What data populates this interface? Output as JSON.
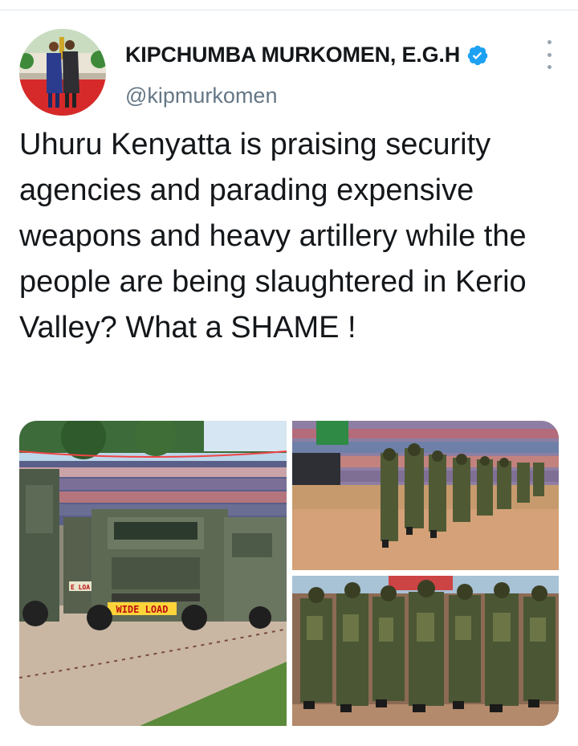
{
  "tweet": {
    "author": {
      "display_name": "KIPCHUMBA MURKOMEN, E.G.H",
      "handle": "@kipmurkomen",
      "verified": true,
      "verified_icon": "verified-badge-icon",
      "avatar_icon": "avatar"
    },
    "more_icon": "more-options-icon",
    "text": "Uhuru Kenyatta is praising security agencies and parading expensive weapons and heavy artillery while the people are being slaughtered in Kerio Valley? What a SHAME !",
    "media": [
      {
        "description": "military-trucks-parade-photo",
        "plate_text": "WIDE LOAD",
        "plate_text_partial": "E LOA"
      },
      {
        "description": "soldiers-marching-stadium-photo"
      },
      {
        "description": "soldiers-marching-closeup-photo"
      }
    ]
  },
  "colors": {
    "verified_blue": "#1da1f2",
    "handle_gray": "#657786",
    "text_black": "#14171a"
  }
}
